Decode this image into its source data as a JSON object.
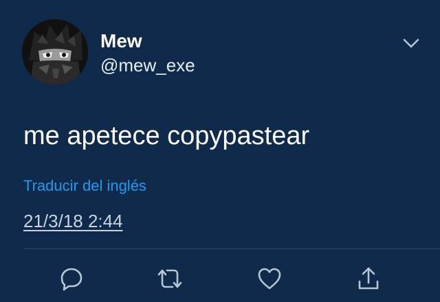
{
  "author": {
    "name": "Mew",
    "handle": "@mew_exe"
  },
  "tweet": {
    "text": "me apetece copypastear",
    "translate_link": "Traducir del inglés",
    "timestamp": "21/3/18 2:44"
  },
  "icons": {
    "more": "chevron-down-icon",
    "reply": "reply-icon",
    "retweet": "retweet-icon",
    "like": "heart-icon",
    "share": "share-icon"
  },
  "colors": {
    "background": "#0f2a4a",
    "link": "#1d9bf0",
    "icon": "#b9c6d3"
  }
}
